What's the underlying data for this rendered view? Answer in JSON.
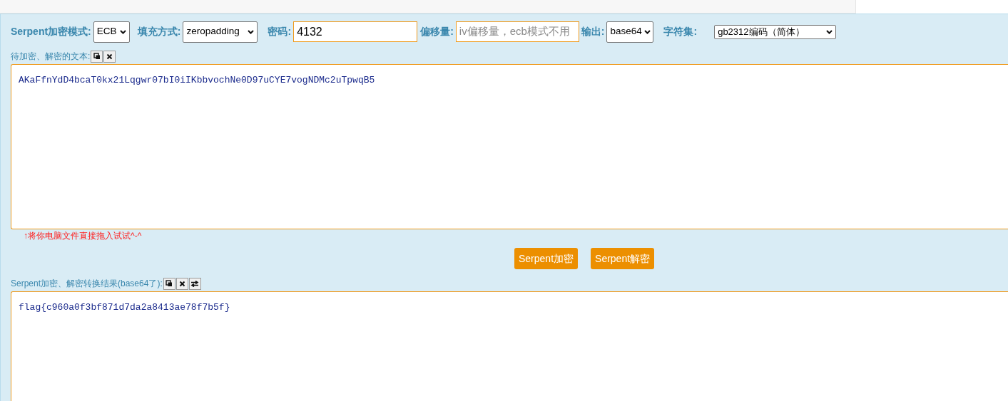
{
  "settings": [
    {
      "kind": "select",
      "label": "Serpent加密模式:",
      "value": "ECB"
    },
    {
      "kind": "select",
      "label": "填充方式:",
      "value": "zeropadding"
    },
    {
      "kind": "input",
      "label": "密码:",
      "value": "4132"
    },
    {
      "kind": "input",
      "label": "偏移量:",
      "placeholder": "iv偏移量，ecb模式不用"
    },
    {
      "kind": "select",
      "label": "输出:",
      "value": "base64"
    },
    {
      "kind": "select",
      "label": "字符集:",
      "value": "gb2312编码（简体）"
    }
  ],
  "input_section": {
    "label": "待加密、解密的文本:",
    "value": "AKaFfnYdD4bcaT0kx21Lqgwr07bI0iIKbbvochNe0D97uCYE7vogNDMc2uTpwqB5",
    "hint": "↑将你电脑文件直接拖入试试^-^"
  },
  "actions": [
    "Serpent加密",
    "Serpent解密"
  ],
  "output_section": {
    "label": "Serpent加密、解密转换结果(base64了):",
    "value": "flag{c960a0f3bf871d7da2a8413ae78f7b5f}"
  }
}
